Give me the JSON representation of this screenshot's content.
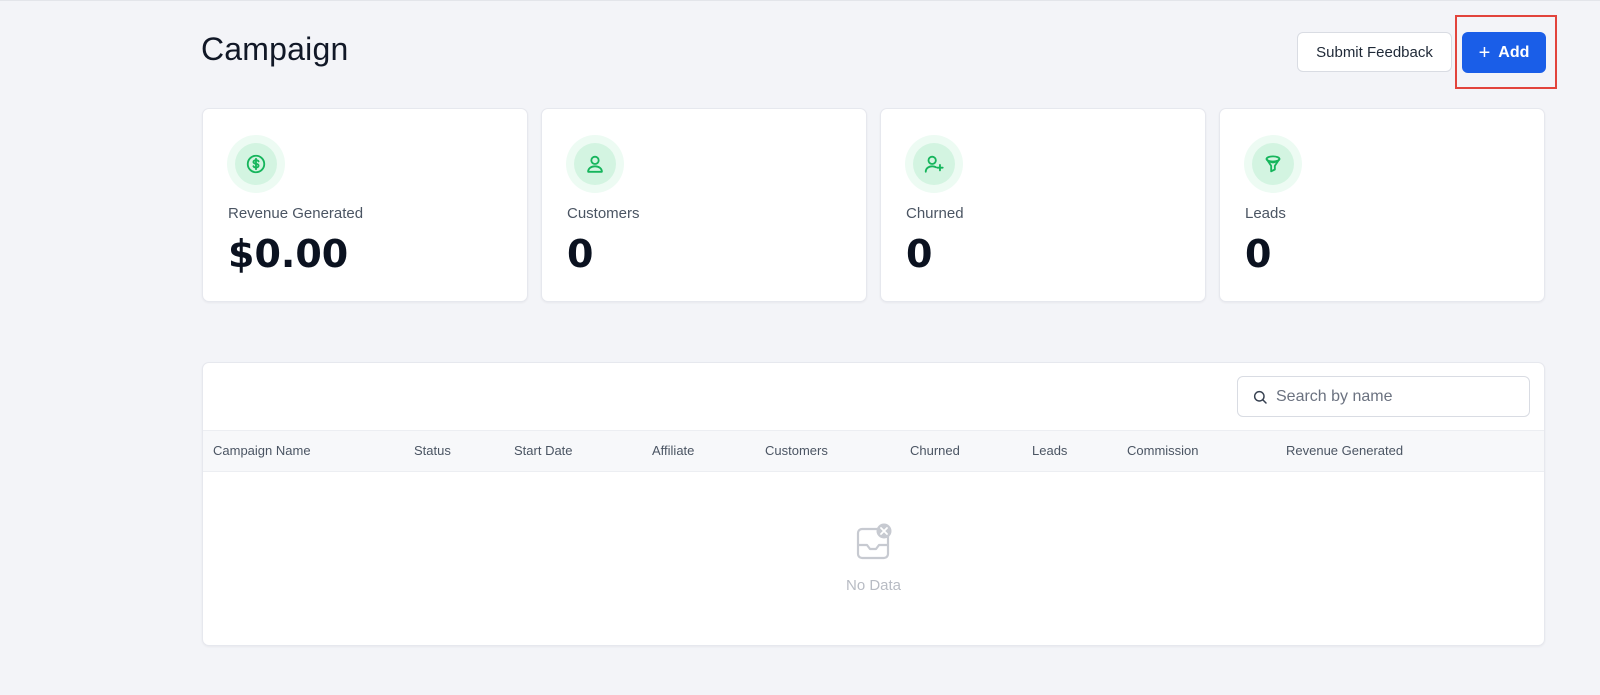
{
  "header": {
    "title": "Campaign",
    "feedback_label": "Submit Feedback",
    "add_label": "Add"
  },
  "stats": [
    {
      "label": "Revenue Generated",
      "value": "$0.00",
      "icon": "dollar-icon"
    },
    {
      "label": "Customers",
      "value": "0",
      "icon": "user-icon"
    },
    {
      "label": "Churned",
      "value": "0",
      "icon": "user-plus-icon"
    },
    {
      "label": "Leads",
      "value": "0",
      "icon": "funnel-icon"
    }
  ],
  "table": {
    "search_placeholder": "Search by name",
    "columns": [
      "Campaign Name",
      "Status",
      "Start Date",
      "Affiliate",
      "Customers",
      "Churned",
      "Leads",
      "Commission",
      "Revenue Generated"
    ],
    "rows": [],
    "empty_text": "No Data"
  },
  "colors": {
    "accent": "#1a5ee8",
    "icon_green": "#16b55c",
    "highlight": "#e2443c"
  }
}
